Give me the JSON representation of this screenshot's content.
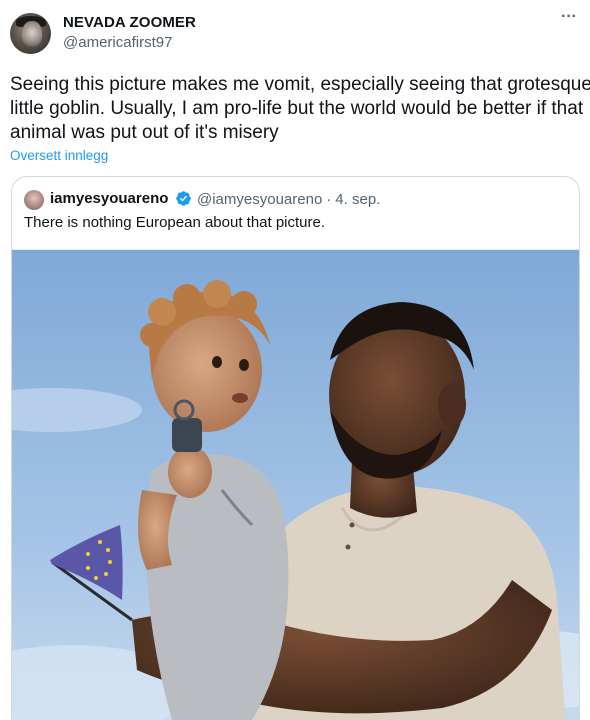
{
  "author": {
    "display_name": "NEVADA ZOOMER",
    "handle": "@americafirst97",
    "avatar_icon": "profile-avatar"
  },
  "more_icon": "···",
  "tweet": {
    "lines": [
      "Seeing this picture makes me vomit, especially seeing that grotesque",
      "little goblin. Usually, I am pro-life but the world would be better if that",
      "animal was put out of it's misery"
    ],
    "translate_label": "Oversett innlegg"
  },
  "quoted": {
    "display_name": "iamyesyouareno",
    "verified": true,
    "handle": "@iamyesyouareno",
    "separator": "·",
    "date": "4. sep.",
    "text": "There is nothing European about that picture.",
    "photo_icon": "photo-man-holding-toddler-with-eu-flag"
  },
  "colors": {
    "link": "#1d9bf0",
    "secondary_text": "#536471",
    "border": "#cfd9de",
    "verified": "#1d9bf0",
    "sky": "#8fb4dd"
  }
}
